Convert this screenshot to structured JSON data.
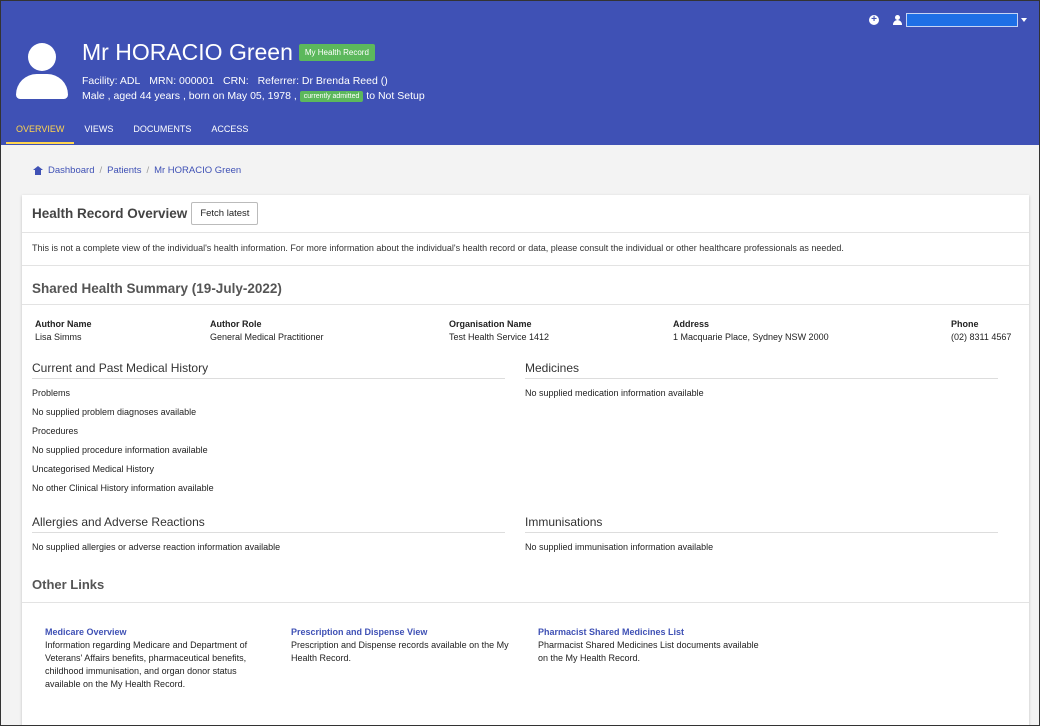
{
  "header": {
    "patient_name": "Mr HORACIO Green",
    "record_badge": "My Health Record",
    "facility": "Facility: ADL",
    "mrn": "MRN: 000001",
    "crn": "CRN:",
    "referrer": "Referrer: Dr Brenda Reed ()",
    "demographics": "Male , aged 44 years , born on May 05, 1978 ,",
    "admission_badge": "currently admitted",
    "admission_suffix": "to Not Setup"
  },
  "tabs": [
    {
      "label": "OVERVIEW",
      "active": true
    },
    {
      "label": "VIEWS"
    },
    {
      "label": "DOCUMENTS"
    },
    {
      "label": "ACCESS"
    }
  ],
  "breadcrumb": [
    "Dashboard",
    "Patients",
    "Mr HORACIO Green"
  ],
  "overview": {
    "title": "Health Record Overview",
    "fetch_label": "Fetch latest",
    "disclaimer": "This is not a complete view of the individual's health information. For more information about the individual's health record or data, please consult the individual or other healthcare professionals as needed."
  },
  "summary": {
    "title": "Shared Health Summary (19-July-2022)",
    "columns": [
      {
        "label": "Author Name",
        "value": "Lisa Simms"
      },
      {
        "label": "Author Role",
        "value": "General Medical Practitioner"
      },
      {
        "label": "Organisation Name",
        "value": "Test Health Service 1412"
      },
      {
        "label": "Address",
        "value": "1 Macquarie Place, Sydney NSW 2000"
      },
      {
        "label": "Phone",
        "value": "(02) 8311 4567"
      }
    ]
  },
  "sections": {
    "history": {
      "title": "Current and Past Medical History",
      "items": [
        "Problems",
        "No supplied problem diagnoses available",
        "Procedures",
        "No supplied procedure information available",
        "Uncategorised Medical History",
        "No other Clinical History information available"
      ]
    },
    "medicines": {
      "title": "Medicines",
      "items": [
        "No supplied medication information available"
      ]
    },
    "allergies": {
      "title": "Allergies and Adverse Reactions",
      "items": [
        "No supplied allergies or adverse reaction information available"
      ]
    },
    "immunisations": {
      "title": "Immunisations",
      "items": [
        "No supplied immunisation information available"
      ]
    }
  },
  "other_links": {
    "title": "Other Links",
    "links": [
      {
        "title": "Medicare Overview",
        "desc": "Information regarding Medicare and Department of Veterans' Affairs benefits, pharmaceutical benefits, childhood immunisation, and organ donor status available on the My Health Record."
      },
      {
        "title": "Prescription and Dispense View",
        "desc": "Prescription and Dispense records available on the My Health Record."
      },
      {
        "title": "Pharmacist Shared Medicines List",
        "desc": "Pharmacist Shared Medicines List documents available on the My Health Record."
      }
    ]
  },
  "colors": {
    "header": "#3f51b5",
    "badge": "#5cb85c",
    "tab_active": "#ffd54f",
    "link": "#3f51b5"
  },
  "icons": [
    "plus-circle-icon",
    "user-icon",
    "chevron-down-icon",
    "avatar-icon",
    "home-icon"
  ]
}
